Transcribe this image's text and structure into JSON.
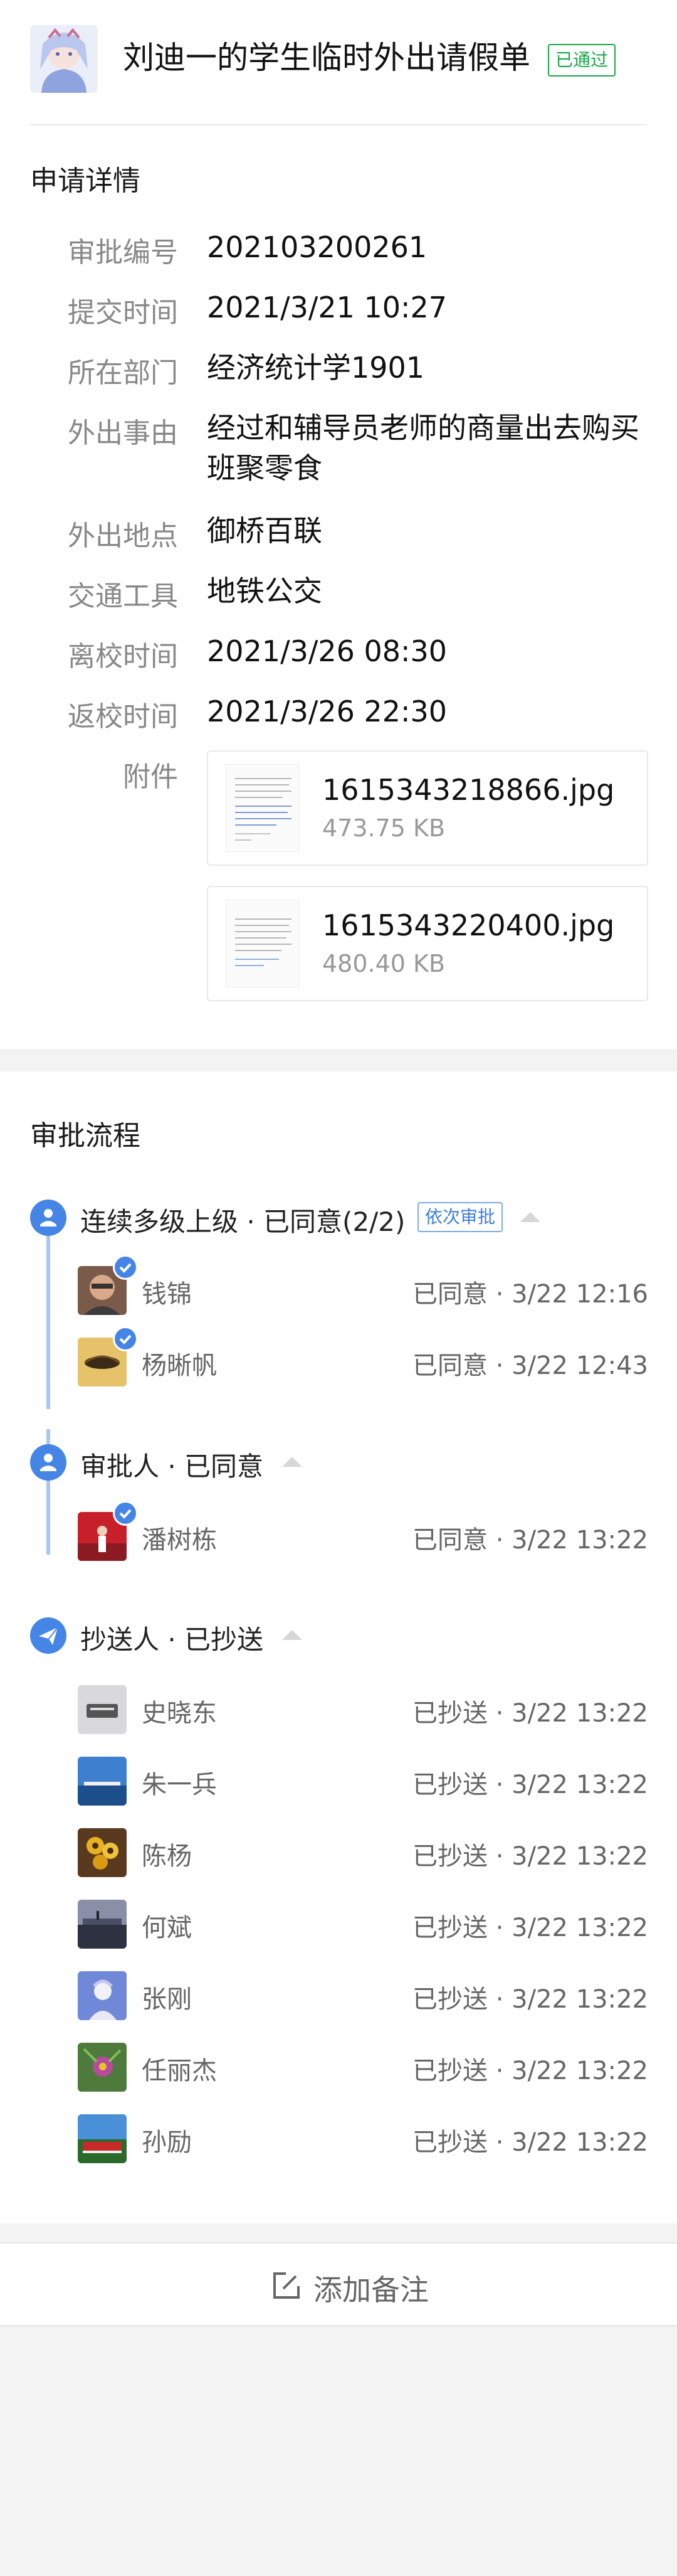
{
  "header": {
    "title": "刘迪一的学生临时外出请假单",
    "status": "已通过"
  },
  "details": {
    "section_title": "申请详情",
    "rows": [
      {
        "label": "审批编号",
        "value": "202103200261"
      },
      {
        "label": "提交时间",
        "value": "2021/3/21 10:27"
      },
      {
        "label": "所在部门",
        "value": "经济统计学1901"
      },
      {
        "label": "外出事由",
        "value": "经过和辅导员老师的商量出去购买班聚零食"
      },
      {
        "label": "外出地点",
        "value": "御桥百联"
      },
      {
        "label": "交通工具",
        "value": "地铁公交"
      },
      {
        "label": "离校时间",
        "value": "2021/3/26 08:30"
      },
      {
        "label": "返校时间",
        "value": "2021/3/26 22:30"
      }
    ],
    "attachments_label": "附件",
    "attachments": [
      {
        "name": "1615343218866.jpg",
        "size": "473.75 KB"
      },
      {
        "name": "1615343220400.jpg",
        "size": "480.40 KB"
      }
    ]
  },
  "flow": {
    "section_title": "审批流程",
    "node1": {
      "text": "连续多级上级 · 已同意(2/2)",
      "tag": "依次审批"
    },
    "node1_people": [
      {
        "name": "钱锦",
        "status": "已同意 · 3/22 12:16"
      },
      {
        "name": "杨晰帆",
        "status": "已同意 · 3/22 12:43"
      }
    ],
    "node2": {
      "text": "审批人 · 已同意"
    },
    "node2_people": [
      {
        "name": "潘树栋",
        "status": "已同意 · 3/22 13:22"
      }
    ],
    "node3": {
      "text": "抄送人 · 已抄送"
    },
    "node3_people": [
      {
        "name": "史晓东",
        "status": "已抄送 · 3/22 13:22"
      },
      {
        "name": "朱一兵",
        "status": "已抄送 · 3/22 13:22"
      },
      {
        "name": "陈杨",
        "status": "已抄送 · 3/22 13:22"
      },
      {
        "name": "何斌",
        "status": "已抄送 · 3/22 13:22"
      },
      {
        "name": "张刚",
        "status": "已抄送 · 3/22 13:22"
      },
      {
        "name": "任丽杰",
        "status": "已抄送 · 3/22 13:22"
      },
      {
        "name": "孙励",
        "status": "已抄送 · 3/22 13:22"
      }
    ]
  },
  "footer": {
    "add_note_label": "添加备注"
  },
  "colors": {
    "accent": "#4585e6",
    "approved_green": "#1aa84a"
  },
  "icons": [
    "user-icon",
    "send-icon",
    "check-icon",
    "edit-note-icon"
  ]
}
